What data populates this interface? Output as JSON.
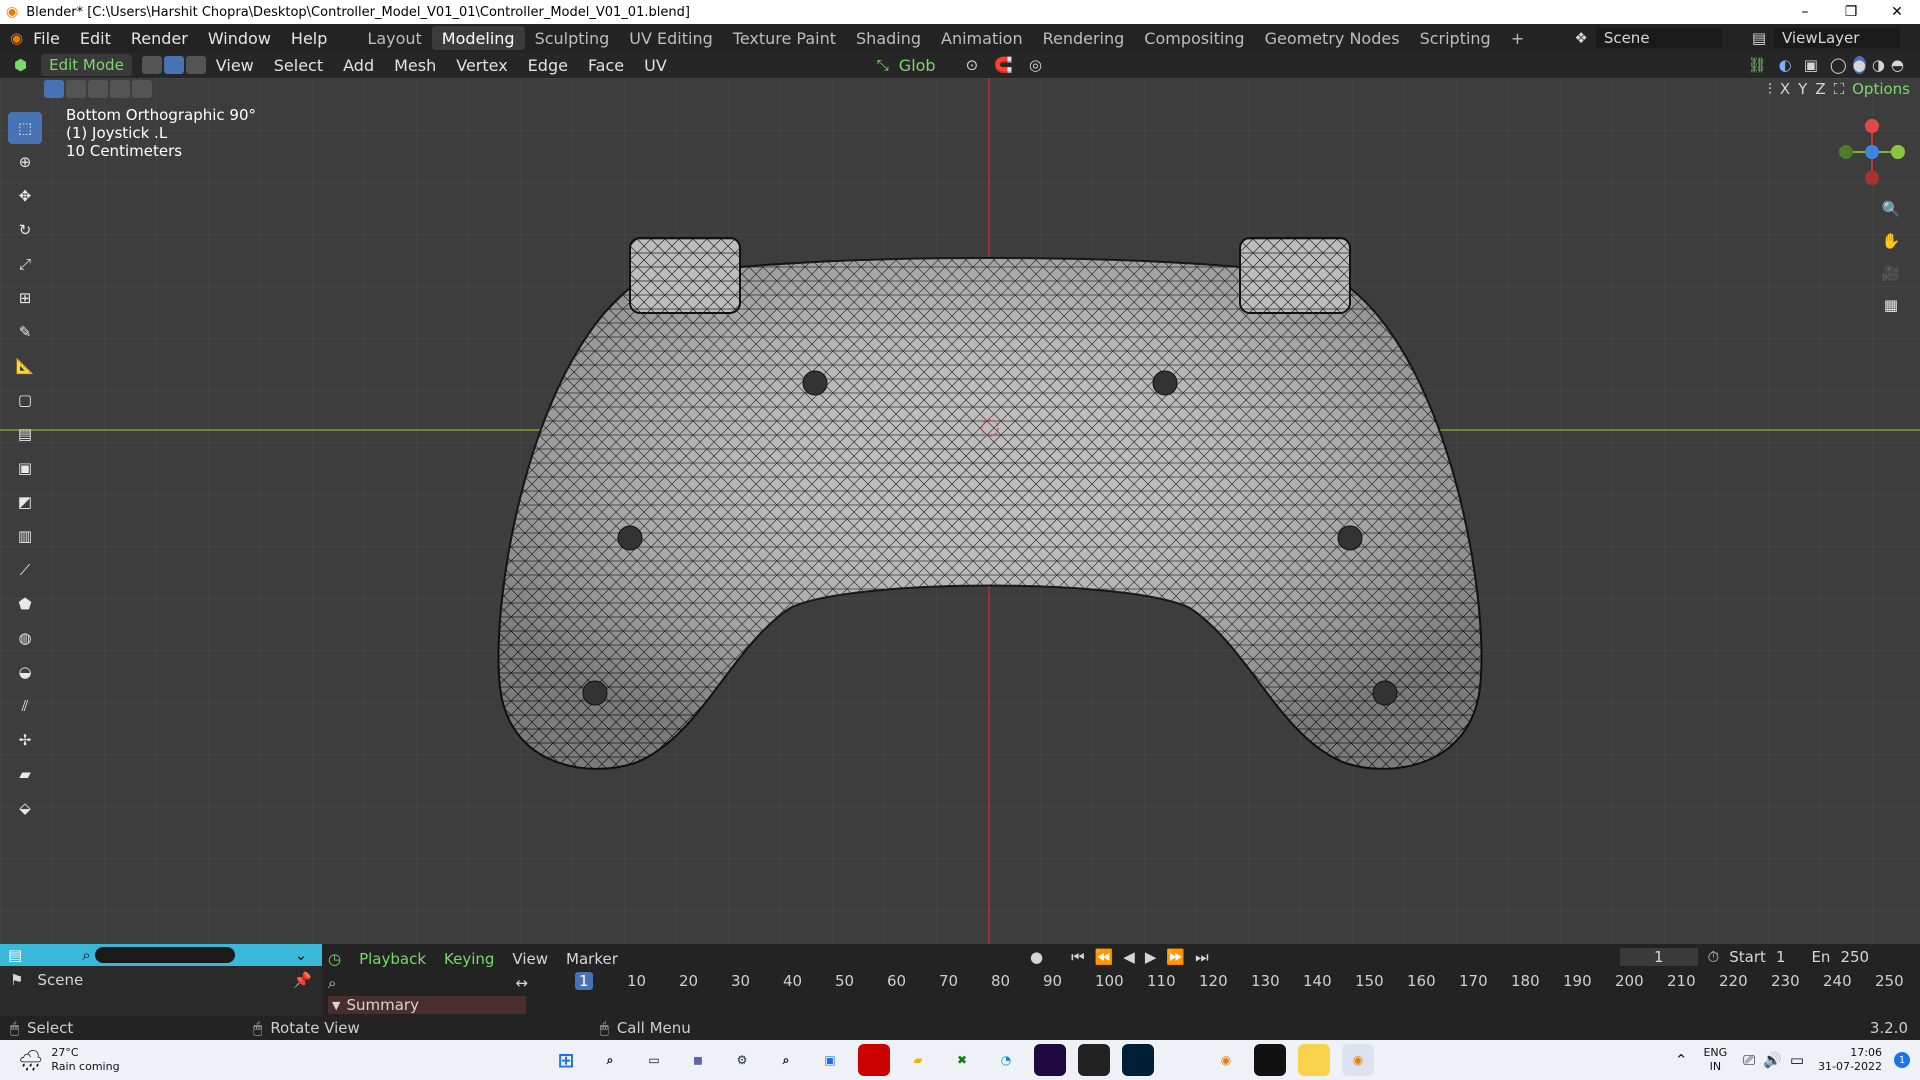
{
  "window": {
    "title": "Blender* [C:\\Users\\Harshit Chopra\\Desktop\\Controller_Model_V01_01\\Controller_Model_V01_01.blend]",
    "minimize": "–",
    "maximize": "❐",
    "close": "✕"
  },
  "menubar": {
    "items": [
      "File",
      "Edit",
      "Render",
      "Window",
      "Help"
    ],
    "workspaces": [
      "Layout",
      "Modeling",
      "Sculpting",
      "UV Editing",
      "Texture Paint",
      "Shading",
      "Animation",
      "Rendering",
      "Compositing",
      "Geometry Nodes",
      "Scripting"
    ],
    "active_workspace": "Modeling",
    "add_workspace": "+",
    "scene": "Scene",
    "view_layer": "ViewLayer"
  },
  "editor_header": {
    "mode": "Edit Mode",
    "menus": [
      "View",
      "Select",
      "Add",
      "Mesh",
      "Vertex",
      "Edge",
      "Face",
      "UV"
    ],
    "orientation": "Glob",
    "axes": [
      "X",
      "Y",
      "Z"
    ],
    "options": "Options"
  },
  "viewport": {
    "view_name": "Bottom Orthographic 90°",
    "object": "(1) Joystick .L",
    "scale": "10 Centimeters"
  },
  "timeline": {
    "menus": [
      "Playback",
      "Keying",
      "View",
      "Marker"
    ],
    "current_frame": "1",
    "start_label": "Start",
    "start": "1",
    "end_label": "En",
    "end": "250",
    "ticks": [
      "1",
      "10",
      "20",
      "30",
      "40",
      "50",
      "60",
      "70",
      "80",
      "90",
      "100",
      "110",
      "120",
      "130",
      "140",
      "150",
      "160",
      "170",
      "180",
      "190",
      "200",
      "210",
      "220",
      "230",
      "240",
      "250"
    ],
    "summary": "Summary",
    "outliner_scene": "Scene"
  },
  "statusbar": {
    "left": "Select",
    "middle": "Rotate View",
    "right": "Call Menu",
    "version": "3.2.0"
  },
  "taskbar": {
    "temp": "27°C",
    "weather": "Rain coming",
    "lang": "ENG",
    "region": "IN",
    "time": "17:06",
    "date": "31-07-2022",
    "notifications": "1"
  }
}
